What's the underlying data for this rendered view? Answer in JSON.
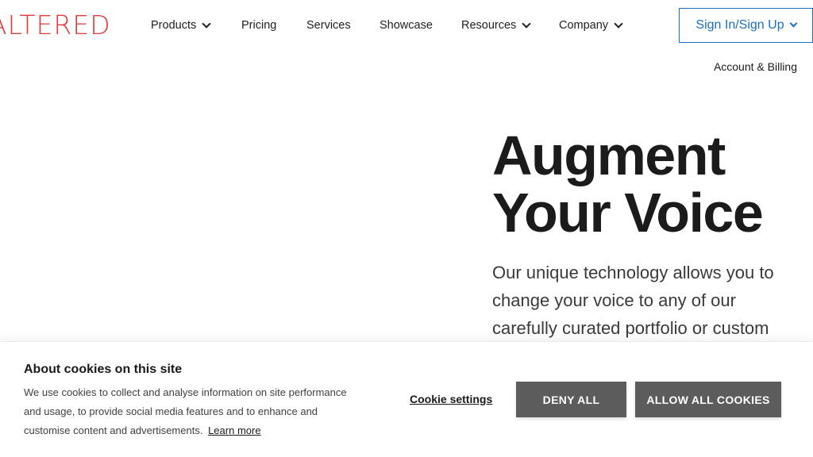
{
  "brand": {
    "logo_text": "ALTERED",
    "accent_color": "#e23b3b"
  },
  "nav": {
    "items": [
      {
        "label": "Products",
        "has_dropdown": true
      },
      {
        "label": "Pricing",
        "has_dropdown": false
      },
      {
        "label": "Services",
        "has_dropdown": false
      },
      {
        "label": "Showcase",
        "has_dropdown": false
      },
      {
        "label": "Resources",
        "has_dropdown": true
      },
      {
        "label": "Company",
        "has_dropdown": true
      }
    ],
    "signin_label": "Sign In/Sign Up",
    "signin_color": "#1c6fc4",
    "account_link": "Account & Billing"
  },
  "hero": {
    "title_line1": "Augment",
    "title_line2": "Your Voice",
    "subtitle_line1": "Our unique technology allows you to",
    "subtitle_line2": "change your voice to any of our",
    "subtitle_line3": "carefully curated portfolio or custom"
  },
  "cookie_banner": {
    "title": "About cookies on this site",
    "text_line1": "We use cookies to collect and analyse information on site performance",
    "text_line2": "and usage, to provide social media features and to enhance and",
    "text_line3": "customise content and advertisements.",
    "learn_more": "Learn more",
    "settings_label": "Cookie settings",
    "deny_label": "DENY ALL",
    "allow_label": "ALLOW ALL COOKIES",
    "button_color": "#5c5c5c"
  }
}
